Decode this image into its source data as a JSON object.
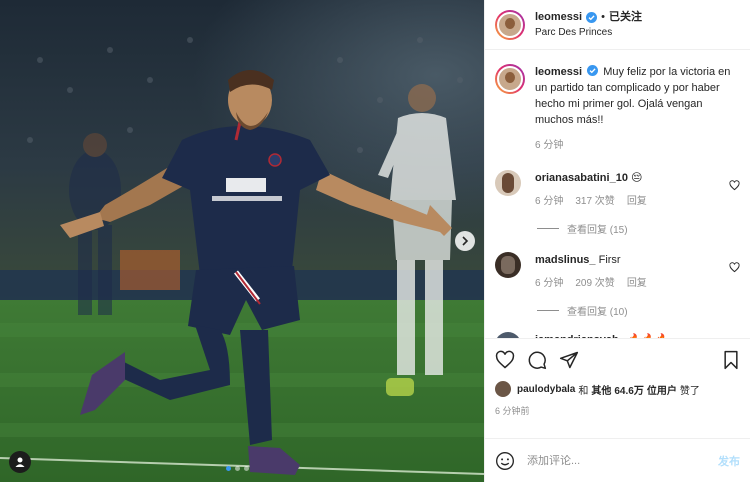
{
  "header": {
    "username": "leomessi",
    "separator": "•",
    "follow_label": "已关注",
    "location": "Parc Des Princes"
  },
  "caption": {
    "username": "leomessi",
    "text": "Muy feliz por la victoria en un partido tan complicado y por haber hecho mi primer gol. Ojalá vengan muchos más!!",
    "time": "6 分钟"
  },
  "comments": [
    {
      "username": "orianasabatini_10",
      "text": "😔",
      "time": "6 分钟",
      "likes": "317 次赞",
      "reply": "回复",
      "view_replies": "查看回复 (15)"
    },
    {
      "username": "madslinus_",
      "text": "Firsr",
      "time": "6 分钟",
      "likes": "209 次赞",
      "reply": "回复",
      "view_replies": "查看回复 (10)"
    },
    {
      "username": "iamandriansyah",
      "text": "🔥🔥🔥"
    }
  ],
  "likes": {
    "user": "paulodybala",
    "and": "和",
    "others_label": "其他",
    "count": "64.6万",
    "suffix": "位用户",
    "liked": "赞了"
  },
  "post_time": "6 分钟前",
  "add_comment": {
    "placeholder": "添加评论...",
    "publish_label": "发布"
  },
  "icons": {
    "like": "heart-icon",
    "comment": "comment-icon",
    "share": "send-icon",
    "save": "bookmark-icon",
    "emoji": "emoji-icon",
    "verified": "verified-badge-icon",
    "next": "chevron-right-icon",
    "tag": "user-tag-icon"
  },
  "carousel": {
    "slide": 1,
    "total": 3
  },
  "colors": {
    "verified": "#3897f0",
    "publish": "#b2dffc",
    "meta": "#8e8e8e",
    "psg_kit": "#1d2b4a"
  }
}
